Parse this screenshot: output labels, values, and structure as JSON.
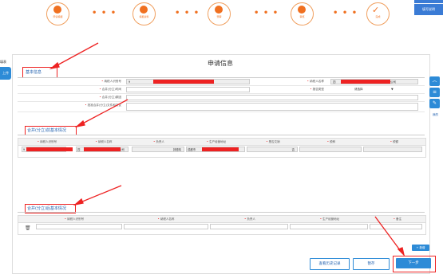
{
  "steps": [
    {
      "label": "申请填报"
    },
    {
      "label": "填报资料"
    },
    {
      "label": "预审"
    },
    {
      "label": "审核"
    },
    {
      "label": "完成"
    }
  ],
  "step_dots": "• • •",
  "help_button": "填写说明",
  "left_panel": {
    "heading": "填表",
    "tab": "上传"
  },
  "page_title": "申请信息",
  "basic_info": {
    "section_title": "基本信息",
    "fields": {
      "taxpayer_id_label": "纳税人识别号",
      "taxpayer_id_value": "9",
      "taxpayer_name_label": "纳税人名称",
      "taxpayer_name_prefix": "四",
      "taxpayer_name_suffix": "公司",
      "merge_time_label": "合并(分立)时间",
      "report_type_label": "报告类型",
      "report_type_value": "请选择",
      "report_type_arrow": "▼",
      "merge_reason_label": "合并(分立)原因",
      "approval_doc_label": "批准合并(分立)文件和决议"
    }
  },
  "before_section": {
    "title": "合并(分立)前基本情况",
    "columns": [
      "纳税人识别号",
      "纳税人名称",
      "负责人",
      "生产经营地址",
      "是否文销",
      "税种",
      "税额"
    ],
    "row": {
      "col1_prefix": "9",
      "col2_prefix": "四",
      "col2_suffix": "公司",
      "col3": "钟德玮",
      "col4_prefix": "成都市",
      "col5": "否"
    }
  },
  "after_section": {
    "title": "合并(分立)后基本情况",
    "columns": [
      "纳税人识别号",
      "纳税人名称",
      "负责人",
      "生产经营地址",
      "备注"
    ],
    "row_icon": "trash-icon"
  },
  "right_float": {
    "up_icon": "chevron-up-icon",
    "list_icon": "list-icon",
    "edit_icon": "pencil-icon",
    "text": "我的"
  },
  "add_button": "+ 新增",
  "buttons": {
    "history": "查看历史记录",
    "save": "暂存",
    "next": "下一步"
  },
  "colors": {
    "accent": "#2d8bd7",
    "step_orange": "#f07020",
    "redaction": "#ee2222",
    "annotation_red": "#e22222"
  }
}
